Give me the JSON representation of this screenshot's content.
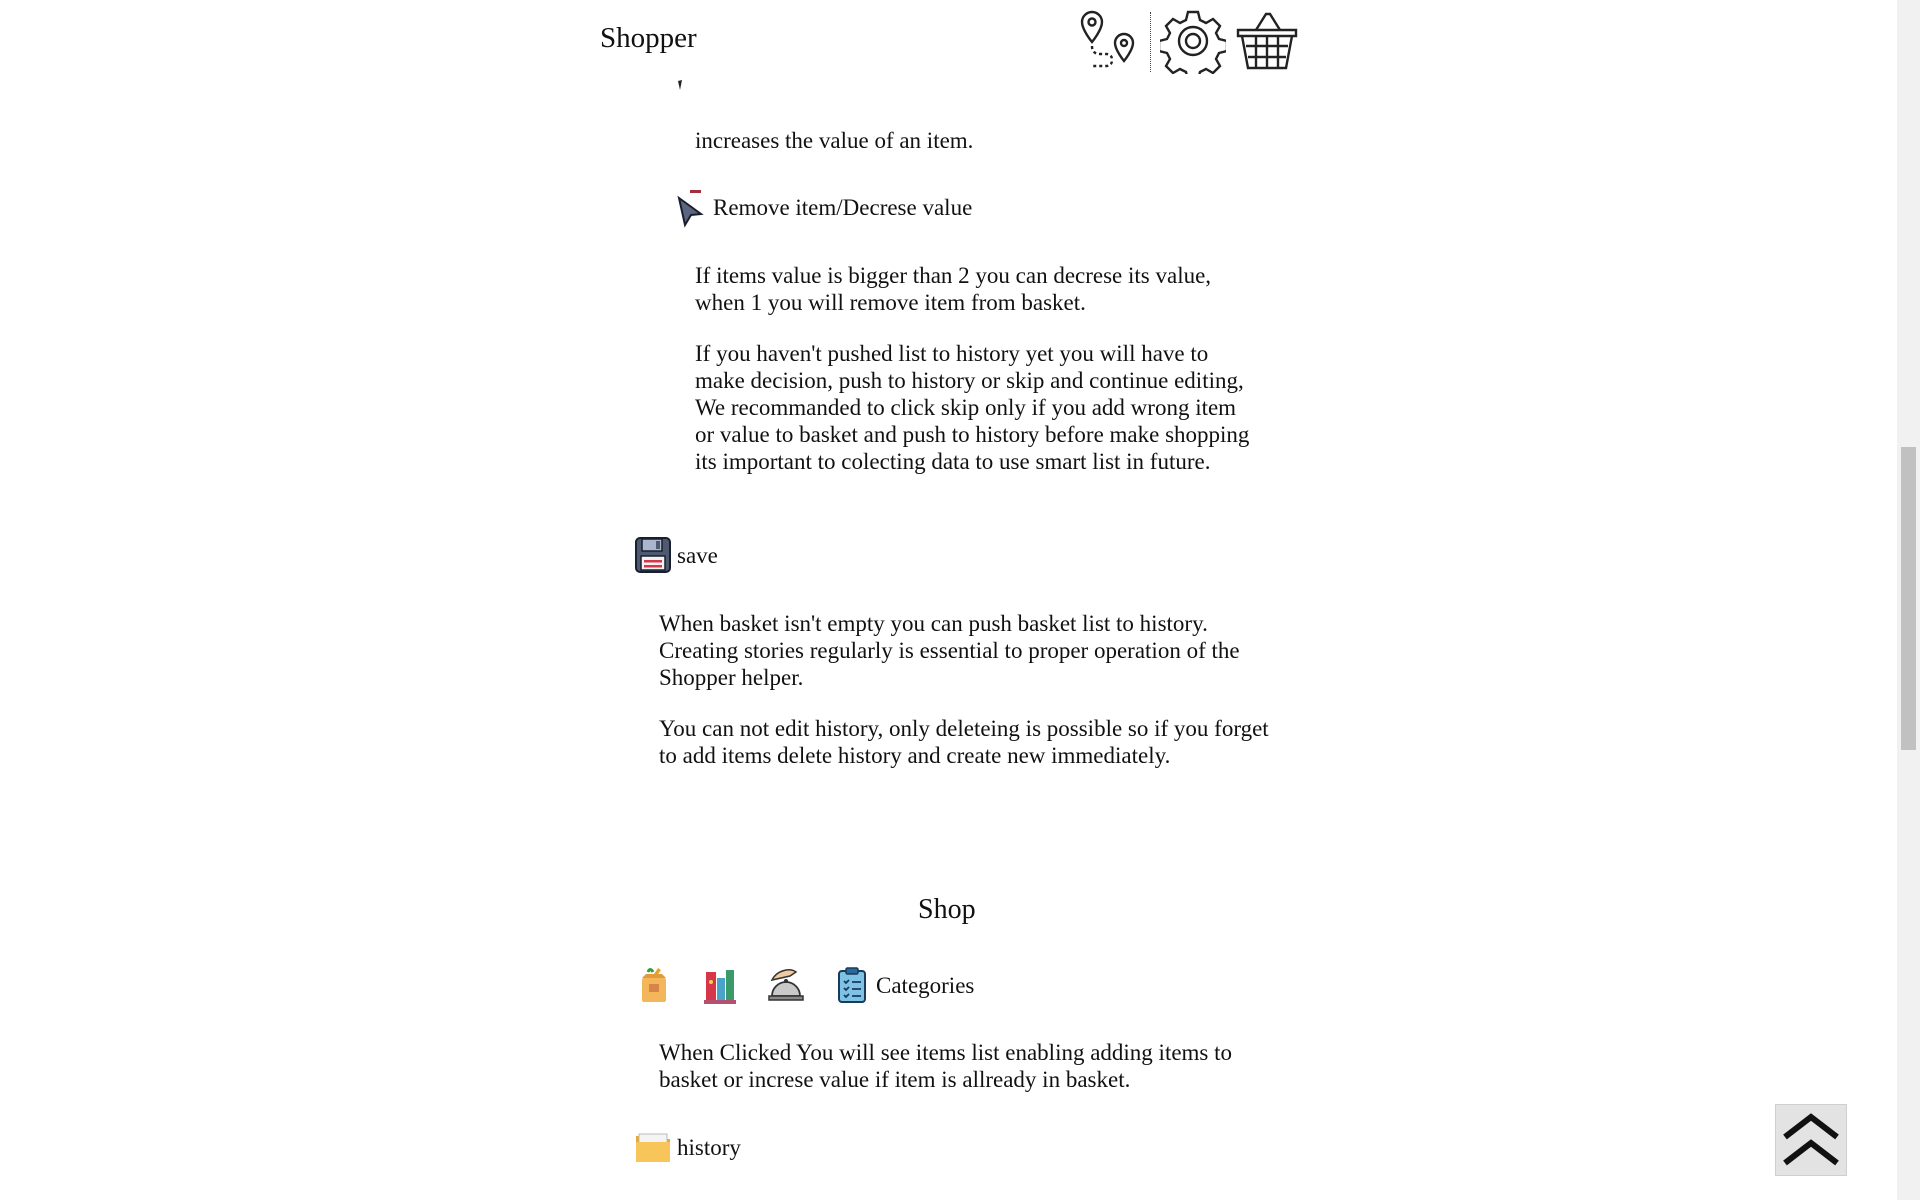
{
  "header": {
    "brand": "Shopper",
    "icons": [
      "map-route-icon",
      "gear-icon",
      "basket-icon"
    ]
  },
  "content": {
    "add_desc": "increases the value of an item.",
    "remove_label": "Remove item/Decrese value",
    "remove_p1": "If items value is bigger than 2 you can decrese its value, when 1 you will remove item from basket.",
    "remove_p2": "If you haven't pushed list to history yet you will have to make decision, push to history or skip and continue editing, We recommanded to click skip only if you add wrong item or value to basket and push to history before make shopping its important to colecting data to use smart list in future.",
    "save_label": "save",
    "save_p1": "When basket isn't empty you can push basket list to history. Creating stories regularly is essential to proper operation of the Shopper helper.",
    "save_p2": "You can not edit history, only deleteing is possible so if you forget to add items delete history and create new immediately.",
    "shop_title": "Shop",
    "categories_label": "Categories",
    "categories_desc": "When Clicked You will see items list enabling adding items to basket or increse value if item is allready in basket.",
    "history_label": "history"
  },
  "colors": {
    "background": "#ffffff",
    "text": "#111111",
    "scroll_top_bg": "#e3e3e3"
  }
}
